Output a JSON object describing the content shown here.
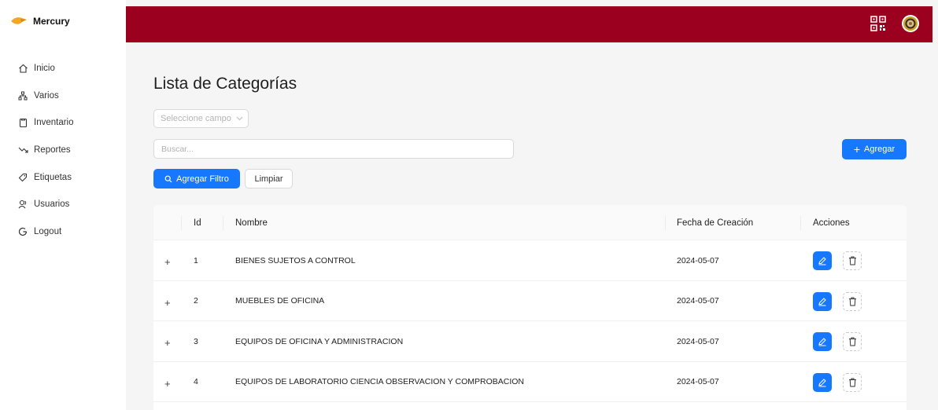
{
  "app": {
    "name": "Mercury"
  },
  "sidebar": {
    "items": [
      {
        "label": "Inicio",
        "icon": "home-icon"
      },
      {
        "label": "Varios",
        "icon": "cluster-icon"
      },
      {
        "label": "Inventario",
        "icon": "clipboard-icon"
      },
      {
        "label": "Reportes",
        "icon": "trend-down-icon"
      },
      {
        "label": "Etiquetas",
        "icon": "tag-icon"
      },
      {
        "label": "Usuarios",
        "icon": "users-icon"
      },
      {
        "label": "Logout",
        "icon": "google-icon"
      }
    ]
  },
  "header": {
    "qr_icon": "qrcode-icon",
    "avatar_icon": "seal-avatar-icon",
    "color": "#9b001e"
  },
  "page": {
    "title": "Lista de Categorías"
  },
  "filters": {
    "field_select_placeholder": "Seleccione campo",
    "search_placeholder": "Buscar...",
    "add_filter_label": "Agregar Filtro",
    "clear_label": "Limpiar",
    "add_label": "Agregar"
  },
  "table": {
    "columns": {
      "id": "Id",
      "name": "Nombre",
      "date": "Fecha de Creación",
      "actions": "Acciones"
    },
    "rows": [
      {
        "expand": "+",
        "id": "1",
        "name": "BIENES SUJETOS A CONTROL",
        "date": "2024-05-07"
      },
      {
        "expand": "+",
        "id": "2",
        "name": "MUEBLES DE OFICINA",
        "date": "2024-05-07"
      },
      {
        "expand": "+",
        "id": "3",
        "name": "EQUIPOS DE OFICINA Y ADMINISTRACION",
        "date": "2024-05-07"
      },
      {
        "expand": "+",
        "id": "4",
        "name": "EQUIPOS DE LABORATORIO CIENCIA OBSERVACION Y COMPROBACION",
        "date": "2024-05-07"
      }
    ]
  },
  "colors": {
    "primary": "#1677ff",
    "brand": "#9b001e"
  }
}
